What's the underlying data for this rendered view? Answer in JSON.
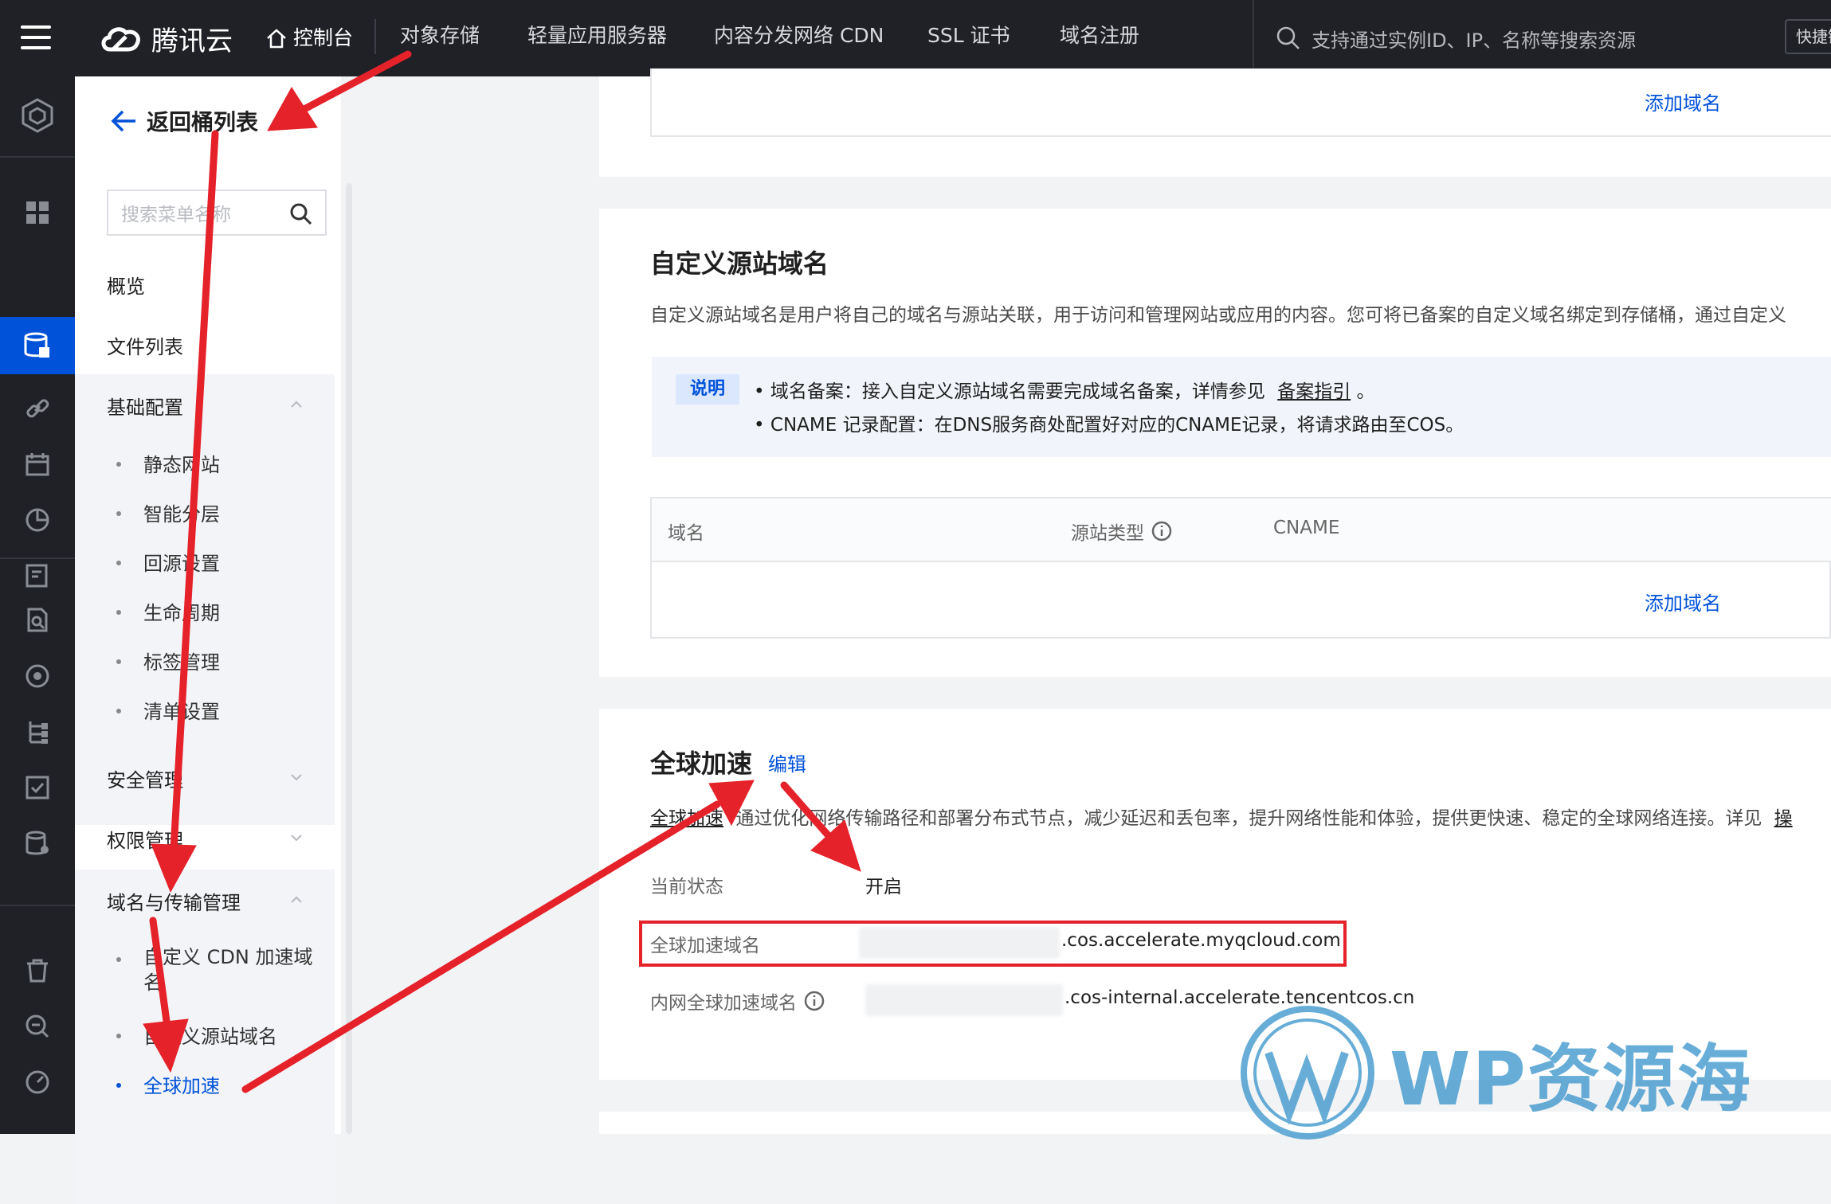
{
  "topbar": {
    "brand": "腾讯云",
    "console": "控制台",
    "nav": [
      "对象存储",
      "轻量应用服务器",
      "内容分发网络 CDN",
      "SSL 证书",
      "域名注册"
    ],
    "search_placeholder": "支持通过实例ID、IP、名称等搜索资源",
    "quick": "快捷键"
  },
  "menu": {
    "back": "返回桶列表",
    "search_placeholder": "搜索菜单名称",
    "overview": "概览",
    "files": "文件列表",
    "basic": "基础配置",
    "basic_items": [
      "静态网站",
      "智能分层",
      "回源设置",
      "生命周期",
      "标签管理",
      "清单设置"
    ],
    "security": "安全管理",
    "permission": "权限管理",
    "domain": "域名与传输管理",
    "domain_items": [
      "自定义 CDN 加速域名",
      "自定义源站域名",
      "全球加速"
    ]
  },
  "top_card": {
    "add_domain": "添加域名"
  },
  "origin_card": {
    "title": "自定义源站域名",
    "desc": "自定义源站域名是用户将自己的域名与源站关联，用于访问和管理网站或应用的内容。您可将已备案的自定义域名绑定到存储桶，通过自定义",
    "notice_tag": "说明",
    "notice_1_prefix": "域名备案：接入自定义源站域名需要完成域名备案，详情参见",
    "notice_1_link": "备案指引",
    "notice_1_suffix": "。",
    "notice_2": "CNAME 记录配置：在DNS服务商处配置好对应的CNAME记录，将请求路由至COS。",
    "col_domain": "域名",
    "col_origin_type": "源站类型",
    "col_cname": "CNAME",
    "add_domain": "添加域名"
  },
  "accel_card": {
    "title": "全球加速",
    "edit": "编辑",
    "desc_link": "全球加速",
    "desc": "通过优化网络传输路径和部署分布式节点，减少延迟和丢包率，提升网络性能和体验，提供更快速、稳定的全球网络连接。详见",
    "desc_tail": "操",
    "status_label": "当前状态",
    "status_value": "开启",
    "domain_label": "全球加速域名",
    "domain_value": ".cos.accelerate.myqcloud.com",
    "internal_label": "内网全球加速域名",
    "internal_value": ".cos-internal.accelerate.tencentcos.cn"
  },
  "watermark": {
    "text": "WP资源海"
  },
  "colors": {
    "accent": "#0052d9",
    "annotation": "#e5222a",
    "topbar": "#1f2127"
  }
}
